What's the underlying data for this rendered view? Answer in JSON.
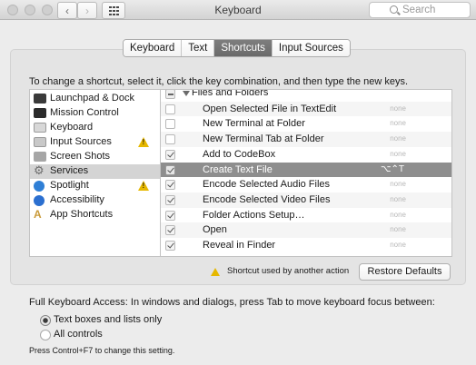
{
  "window": {
    "title": "Keyboard",
    "search_placeholder": "Search",
    "back_glyph": "‹",
    "forward_glyph": "›"
  },
  "tabs": [
    {
      "label": "Keyboard",
      "active": false
    },
    {
      "label": "Text",
      "active": false
    },
    {
      "label": "Shortcuts",
      "active": true
    },
    {
      "label": "Input Sources",
      "active": false
    }
  ],
  "instructions": "To change a shortcut, select it, click the key combination, and then type the new keys.",
  "categories": [
    {
      "label": "Launchpad & Dock",
      "icon": "launchpad-icon",
      "color": "#3a3a3a",
      "warning": false,
      "selected": false
    },
    {
      "label": "Mission Control",
      "icon": "mission-control-icon",
      "color": "#2b2b2b",
      "warning": false,
      "selected": false
    },
    {
      "label": "Keyboard",
      "icon": "keyboard-icon",
      "color": "#cfcfcf",
      "warning": false,
      "selected": false
    },
    {
      "label": "Input Sources",
      "icon": "input-sources-icon",
      "color": "#bdbdbd",
      "warning": true,
      "selected": false
    },
    {
      "label": "Screen Shots",
      "icon": "screenshot-icon",
      "color": "#9a9a9a",
      "warning": false,
      "selected": false
    },
    {
      "label": "Services",
      "icon": "gear-icon",
      "color": "#808080",
      "warning": false,
      "selected": true
    },
    {
      "label": "Spotlight",
      "icon": "spotlight-icon",
      "color": "#2f7fd6",
      "warning": true,
      "selected": false
    },
    {
      "label": "Accessibility",
      "icon": "accessibility-icon",
      "color": "#2b6fd0",
      "warning": false,
      "selected": false
    },
    {
      "label": "App Shortcuts",
      "icon": "app-shortcuts-icon",
      "color": "#c99a3a",
      "warning": false,
      "selected": false
    }
  ],
  "services_group": {
    "label": "Files and Folders",
    "state": "mixed"
  },
  "services": [
    {
      "label": "Open Selected File in TextEdit",
      "checked": false,
      "shortcut": "none",
      "selected": false
    },
    {
      "label": "New Terminal at Folder",
      "checked": false,
      "shortcut": "none",
      "selected": false
    },
    {
      "label": "New Terminal Tab at Folder",
      "checked": false,
      "shortcut": "none",
      "selected": false
    },
    {
      "label": "Add to CodeBox",
      "checked": true,
      "shortcut": "none",
      "selected": false
    },
    {
      "label": "Create Text File",
      "checked": true,
      "shortcut": "⌥⌃T",
      "selected": true
    },
    {
      "label": "Encode Selected Audio Files",
      "checked": true,
      "shortcut": "none",
      "selected": false
    },
    {
      "label": "Encode Selected Video Files",
      "checked": true,
      "shortcut": "none",
      "selected": false
    },
    {
      "label": "Folder Actions Setup…",
      "checked": true,
      "shortcut": "none",
      "selected": false
    },
    {
      "label": "Open",
      "checked": true,
      "shortcut": "none",
      "selected": false
    },
    {
      "label": "Reveal in Finder",
      "checked": true,
      "shortcut": "none",
      "selected": false
    }
  ],
  "conflict_note": "Shortcut used by another action",
  "restore_button": "Restore Defaults",
  "full_keyboard_access": {
    "label": "Full Keyboard Access: In windows and dialogs, press Tab to move keyboard focus between:",
    "options": [
      {
        "label": "Text boxes and lists only",
        "selected": true
      },
      {
        "label": "All controls",
        "selected": false
      }
    ],
    "hint": "Press Control+F7 to change this setting."
  },
  "colors": {
    "selected_row": "#8e8e8e",
    "active_tab": "#6f6f6f",
    "warning": "#e6b800"
  }
}
